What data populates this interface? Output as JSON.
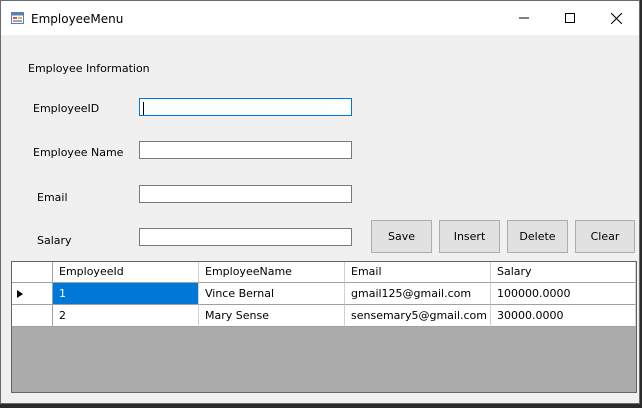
{
  "window": {
    "title": "EmployeeMenu",
    "icons": {
      "app": "form-icon",
      "minimize": "minimize-icon",
      "maximize": "maximize-icon",
      "close": "close-icon"
    }
  },
  "form": {
    "heading": "Employee Information",
    "labels": {
      "employee_id": "EmployeeID",
      "employee_name": "Employee Name",
      "email": "Email",
      "salary": "Salary"
    },
    "values": {
      "employee_id": "",
      "employee_name": "",
      "email": "",
      "salary": ""
    }
  },
  "buttons": {
    "save": "Save",
    "insert": "Insert",
    "delete": "Delete",
    "clear": "Clear"
  },
  "grid": {
    "columns": [
      "EmployeeId",
      "EmployeeName",
      "Email",
      "Salary"
    ],
    "rows": [
      [
        "1",
        "Vince Bernal",
        "gmail125@gmail.com",
        "100000.0000"
      ],
      [
        "2",
        "Mary Sense",
        "sensemary5@gmail.com",
        "30000.0000"
      ]
    ],
    "current_row_icon": "row-pointer-icon"
  },
  "colors": {
    "selection": "#0078d7",
    "window_bg": "#f0f0f0",
    "grid_empty_bg": "#ababab"
  }
}
